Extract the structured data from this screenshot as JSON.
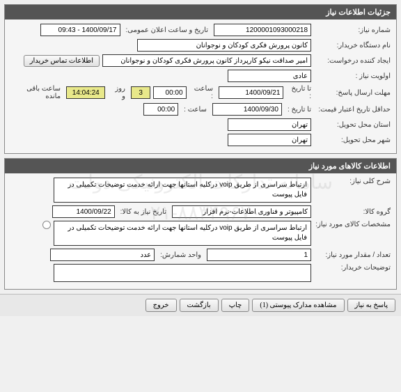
{
  "watermark_line1": "سامانه تدارکات الکترونیکی دولت",
  "watermark_line2": "۰۲۱-۸۸۳۴۹۶۷۰",
  "panel1": {
    "title": "جزئیات اطلاعات نیاز",
    "need_number_label": "شماره نیاز:",
    "need_number": "1200001093000218",
    "announce_label": "تاریخ و ساعت اعلان عمومی:",
    "announce_value": "1400/09/17 - 09:43",
    "buyer_label": "نام دستگاه خریدار:",
    "buyer": "کانون پرورش فکری کودکان و نوجوانان",
    "creator_label": "ایجاد کننده درخواست:",
    "creator": "امیر صداقت نیکو کارپرداز کانون پرورش فکری کودکان و نوجوانان",
    "contact_btn": "اطلاعات تماس خریدار",
    "priority_label": "اولویت نیاز :",
    "priority": "عادی",
    "deadline_label": "مهلت ارسال پاسخ:",
    "until_label": "تا تاریخ :",
    "deadline_date": "1400/09/21",
    "time_label": "ساعت :",
    "deadline_time": "00:00",
    "days_val": "3",
    "days_and": "روز و",
    "remain_time": "14:04:24",
    "remain_label": "ساعت باقی مانده",
    "validity_label": "حداقل تاریخ اعتبار قیمت:",
    "validity_date": "1400/09/30",
    "validity_time": "00:00",
    "delivery_province_label": "استان محل تحویل:",
    "delivery_province": "تهران",
    "delivery_city_label": "شهر محل تحویل:",
    "delivery_city": "تهران"
  },
  "panel2": {
    "title": "اطلاعات کالاهای مورد نیاز",
    "desc_label": "شرح کلی نیاز:",
    "desc": "ارتباط سراسری از طریق voip درکلیه استانها جهت ارائه خدمت توضیحات تکمیلی در فایل پیوست",
    "group_label": "گروه کالا:",
    "group": "کامپیوتر و فناوری اطلاعات-نرم افزار",
    "need_date_label": "تاریخ نیاز به کالا:",
    "need_date": "1400/09/22",
    "spec_label": "مشخصات کالای مورد نیاز:",
    "spec": "ارتباط سراسری از طریق voip درکلیه استانها جهت ارائه خدمت توضیحات تکمیلی در فایل پیوست",
    "qty_label": "تعداد / مقدار مورد نیاز:",
    "qty": "1",
    "unit_label": "واحد شمارش:",
    "unit": "عدد",
    "buyer_notes_label": "توضیحات خریدار:",
    "buyer_notes": ""
  },
  "buttons": {
    "respond": "پاسخ به نیاز",
    "attachments": "مشاهده مدارک پیوستی (1)",
    "print": "چاپ",
    "back": "بازگشت",
    "exit": "خروج"
  }
}
